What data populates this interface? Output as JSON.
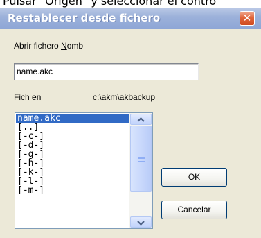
{
  "background_text": "Pulsar \"Origen\" y seleccionar el contro",
  "window": {
    "title": "Restablecer desde fichero",
    "close_glyph": "✕"
  },
  "open_file": {
    "label_prefix": "Abrir fichero ",
    "label_accel": "N",
    "label_suffix": "omb",
    "value": "name.akc"
  },
  "location": {
    "label_accel": "F",
    "label_suffix": "ich en",
    "path": "c:\\akm\\akbackup"
  },
  "file_list": {
    "items": [
      "name.akc",
      "[..]",
      "[-c-]",
      "[-d-]",
      "[-g-]",
      "[-h-]",
      "[-k-]",
      "[-l-]",
      "[-m-]"
    ],
    "selected_index": 0
  },
  "buttons": {
    "ok": "OK",
    "cancel": "Cancelar"
  },
  "colors": {
    "titlebar": "#9cb1da",
    "dialog_bg": "#ece9d8",
    "selection": "#316ac5"
  }
}
